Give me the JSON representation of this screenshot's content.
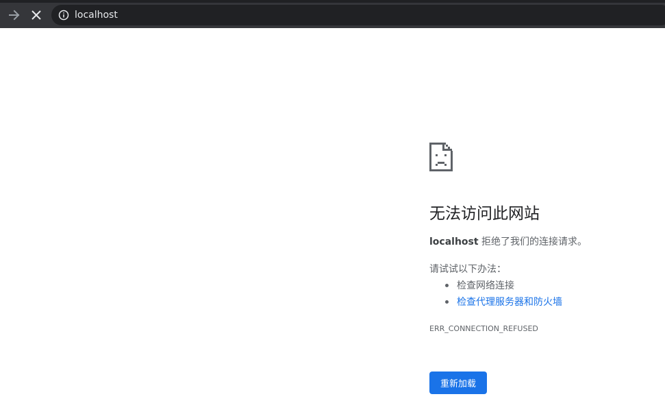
{
  "toolbar": {
    "forward_icon": "arrow-right-icon",
    "stop_icon": "close-icon",
    "url": "localhost",
    "security_icon": "info-icon",
    "colors": {
      "frame": "#35363a",
      "omnibox": "#202124",
      "text": "#e8eaed"
    }
  },
  "error_page": {
    "icon": "sad-document-icon",
    "heading": "无法访问此网站",
    "host": "localhost",
    "summary_rest": " 拒绝了我们的连接请求。",
    "try_label": "请试试以下办法：",
    "suggestions": [
      {
        "text": "检查网络连接",
        "is_link": false
      },
      {
        "text": "检查代理服务器和防火墙",
        "is_link": true
      }
    ],
    "error_code": "ERR_CONNECTION_REFUSED",
    "reload_label": "重新加载",
    "colors": {
      "accent": "#1a73e8",
      "text": "#5f6368",
      "heading": "#202124"
    }
  }
}
